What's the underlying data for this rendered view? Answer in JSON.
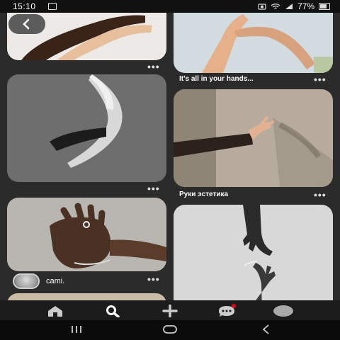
{
  "status": {
    "time": "15:10",
    "battery": "77%"
  },
  "pins": [
    {
      "caption": ""
    },
    {
      "caption": "It's all in your hands..."
    },
    {
      "caption": ""
    },
    {
      "caption": "Руки эстетика"
    },
    {
      "caption": ""
    },
    {
      "caption": ""
    }
  ],
  "profile": {
    "username": "cami."
  },
  "icons": {
    "back": "chevron-left-icon",
    "home": "home-icon",
    "search": "search-icon",
    "create": "plus-icon",
    "messages": "chat-icon",
    "profile": "profile-icon"
  },
  "colors": {
    "background": "#2b2b2b",
    "notification": "#e60023"
  }
}
